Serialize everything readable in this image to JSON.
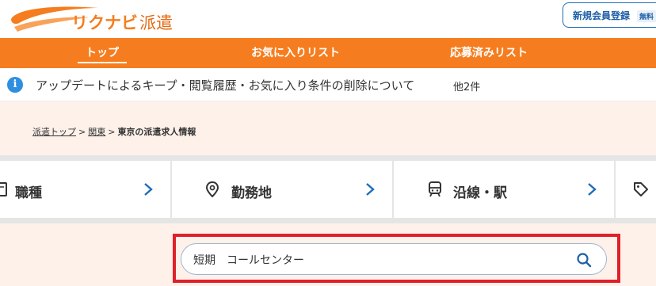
{
  "header": {
    "logo_main": "リクナビ",
    "logo_sub": "派遣",
    "register_label": "新規会員登録",
    "register_badge": "無料"
  },
  "nav": {
    "tabs": [
      {
        "label": "トップ",
        "active": true
      },
      {
        "label": "お気に入りリスト",
        "active": false
      },
      {
        "label": "応募済みリスト",
        "active": false
      }
    ]
  },
  "notice": {
    "icon": "info-icon",
    "text": "アップデートによるキープ・閲覧履歴・お気に入り条件の削除について",
    "count": "他2件"
  },
  "breadcrumb": {
    "items": [
      "派遣トップ",
      "関東"
    ],
    "separator": ">",
    "current": "東京の派遣求人情報"
  },
  "categories": [
    {
      "label": "職種",
      "icon": "document-icon"
    },
    {
      "label": "勤務地",
      "icon": "location-pin-icon"
    },
    {
      "label": "沿線・駅",
      "icon": "train-icon"
    },
    {
      "label": "",
      "icon": "tag-icon"
    }
  ],
  "search": {
    "value": "短期　コールセンター",
    "icon": "search-icon"
  },
  "colors": {
    "brand_orange": "#f57d1f",
    "accent_blue": "#1f6cb8",
    "highlight_red": "#e0202a",
    "cream_bg": "#fdf1ea"
  }
}
